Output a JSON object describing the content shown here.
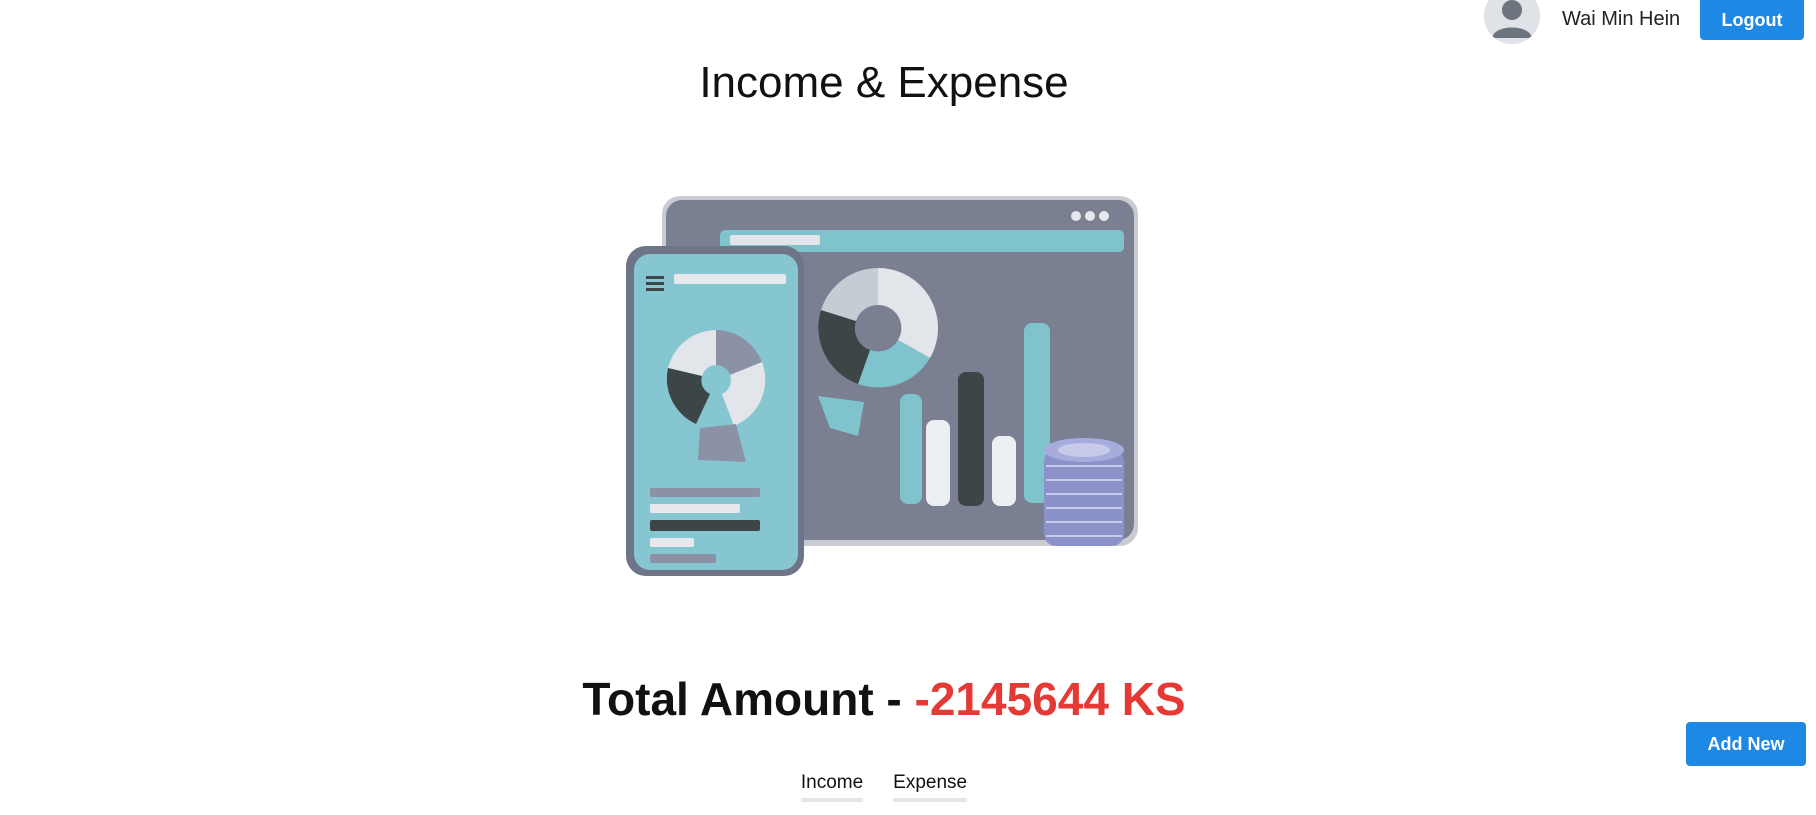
{
  "header": {
    "user_name": "Wai Min Hein",
    "logout_label": "Logout",
    "avatar_icon": "user-avatar-icon"
  },
  "main": {
    "title": "Income & Expense",
    "illustration": "dashboard-illustration",
    "total_label": "Total Amount - ",
    "total_amount": "-2145644 KS",
    "add_new_label": "Add New"
  },
  "tabs": [
    {
      "label": "Income"
    },
    {
      "label": "Expense"
    }
  ],
  "colors": {
    "primary": "#1e88e5",
    "negative": "#e53935",
    "text": "#111111"
  }
}
